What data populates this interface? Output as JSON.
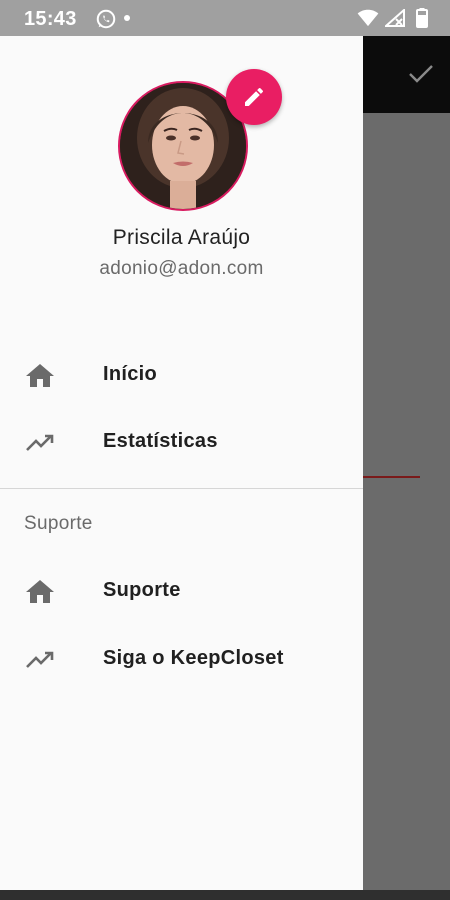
{
  "status_bar": {
    "time": "15:43",
    "icons": [
      "whatsapp-icon",
      "notification-dot-icon",
      "wifi-icon",
      "signal-icon",
      "battery-icon"
    ]
  },
  "background_app": {
    "action_icon": "check-icon"
  },
  "drawer": {
    "profile": {
      "name": "Priscila Araújo",
      "email": "adonio@adon.com",
      "edit_icon": "pencil-icon"
    },
    "menu": [
      {
        "label": "Início",
        "icon": "home-icon"
      },
      {
        "label": "Estatísticas",
        "icon": "trending-up-icon"
      }
    ],
    "support_section": {
      "title": "Suporte",
      "items": [
        {
          "label": "Suporte",
          "icon": "home-icon"
        },
        {
          "label": "Siga o KeepCloset",
          "icon": "trending-up-icon"
        }
      ]
    }
  },
  "colors": {
    "accent": "#e91e63",
    "drawer_bg": "#fafafa",
    "scrim": "#6b6b6b",
    "status_bar": "#a0a0a0"
  }
}
